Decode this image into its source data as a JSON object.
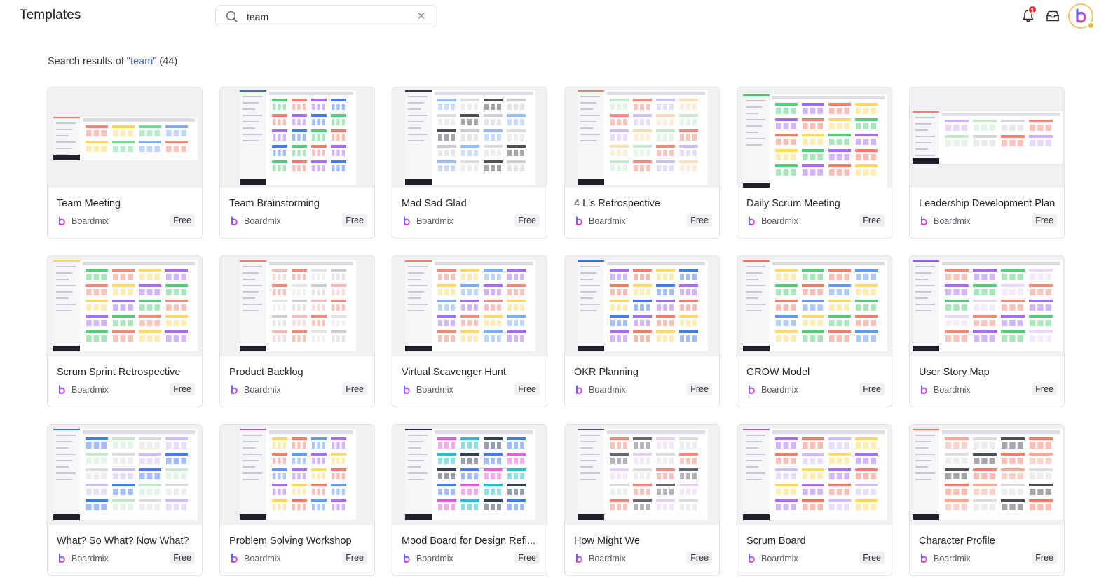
{
  "header": {
    "title": "Templates",
    "search_value": "team",
    "notification_count": "1"
  },
  "results": {
    "prefix": "Search results of \"",
    "keyword": "team",
    "suffix": "\" (44)"
  },
  "colors": {
    "accent": "#4a6cf7",
    "badge": "#e5303b",
    "tag_bg": "#f0f0f2"
  },
  "templates": [
    {
      "name": "Team Meeting",
      "author": "Boardmix",
      "tag": "Free",
      "palette": [
        "#f47c6b",
        "#ffd54f",
        "#69d48a",
        "#7aa7f7"
      ]
    },
    {
      "name": "Team Brainstorming",
      "author": "Boardmix",
      "tag": "Free",
      "palette": [
        "#2f6df6",
        "#3fc86b",
        "#f46f5a",
        "#9b5cf4"
      ]
    },
    {
      "name": "Mad Sad Glad",
      "author": "Boardmix",
      "tag": "Free",
      "palette": [
        "#3a3a42",
        "#c7c7cf",
        "#8ab4ff",
        "#d8d8de"
      ]
    },
    {
      "name": "4 L's Retrospective",
      "author": "Boardmix",
      "tag": "Free",
      "palette": [
        "#f47c6b",
        "#c9b8f5",
        "#fbd9b0",
        "#bfe8c9"
      ]
    },
    {
      "name": "Daily Scrum Meeting",
      "author": "Boardmix",
      "tag": "Free",
      "palette": [
        "#3fc86b",
        "#9b5cf4",
        "#f46f5a",
        "#ffd54f"
      ]
    },
    {
      "name": "Leadership Development Plan",
      "author": "Boardmix",
      "tag": "Free",
      "palette": [
        "#f47c6b",
        "#c9a8f5",
        "#bfe8c9",
        "#d0d0d8"
      ]
    },
    {
      "name": "Scrum Sprint Retrospective",
      "author": "Boardmix",
      "tag": "Free",
      "palette": [
        "#ffd54f",
        "#9b5cf4",
        "#3fc86b",
        "#f47c6b"
      ]
    },
    {
      "name": "Product Backlog",
      "author": "Boardmix",
      "tag": "Free",
      "palette": [
        "#f47c6b",
        "#e0e0e6",
        "#c5c5cd",
        "#f2b3b3"
      ]
    },
    {
      "name": "Virtual Scavenger Hunt",
      "author": "Boardmix",
      "tag": "Free",
      "palette": [
        "#f47c6b",
        "#ffd54f",
        "#6aa6f7",
        "#9b5cf4"
      ]
    },
    {
      "name": "OKR Planning",
      "author": "Boardmix",
      "tag": "Free",
      "palette": [
        "#2f6df6",
        "#9b5cf4",
        "#f46f5a",
        "#ffd54f"
      ]
    },
    {
      "name": "GROW Model",
      "author": "Boardmix",
      "tag": "Free",
      "palette": [
        "#f46f5a",
        "#4c8df7",
        "#ffd54f",
        "#3fc86b"
      ]
    },
    {
      "name": "User Story Map",
      "author": "Boardmix",
      "tag": "Free",
      "palette": [
        "#9b5cf4",
        "#3fc86b",
        "#e6d4f7",
        "#f47c6b"
      ]
    },
    {
      "name": "What? So What? Now What?",
      "author": "Boardmix",
      "tag": "Free",
      "palette": [
        "#2f6df6",
        "#bfe8c9",
        "#d8d8de",
        "#c9b8f5"
      ]
    },
    {
      "name": "Problem Solving Workshop",
      "author": "Boardmix",
      "tag": "Free",
      "palette": [
        "#9b5cf4",
        "#ffd54f",
        "#f46f5a",
        "#4c8df7"
      ]
    },
    {
      "name": "Mood Board for Design Refi...",
      "author": "Boardmix",
      "tag": "Free",
      "palette": [
        "#1e2a4a",
        "#2f6df6",
        "#e94bd8",
        "#0fb8c9"
      ]
    },
    {
      "name": "How Might We",
      "author": "Boardmix",
      "tag": "Free",
      "palette": [
        "#555560",
        "#e6c8f5",
        "#d8d8de",
        "#f47c6b"
      ]
    },
    {
      "name": "Scrum Board",
      "author": "Boardmix",
      "tag": "Free",
      "palette": [
        "#9b5cf4",
        "#f46f5a",
        "#c9b8f5",
        "#ffd54f"
      ]
    },
    {
      "name": "Character Profile",
      "author": "Boardmix",
      "tag": "Free",
      "palette": [
        "#f46f5a",
        "#f4a08a",
        "#d8d8de",
        "#3a3a42"
      ]
    }
  ]
}
